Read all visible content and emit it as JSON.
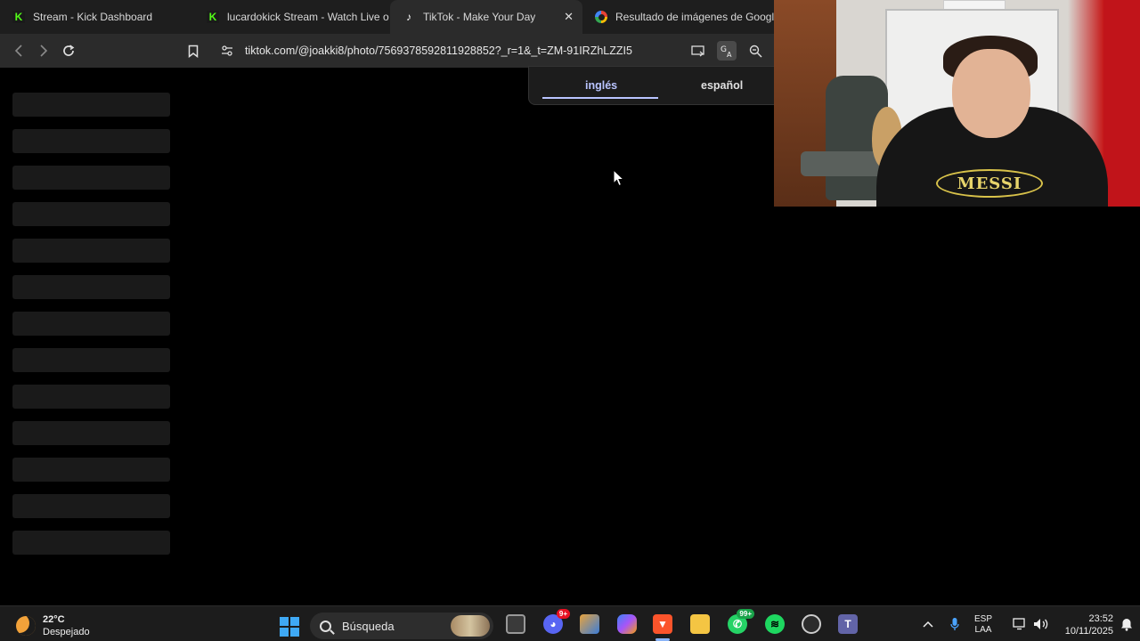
{
  "browser": {
    "tabs": [
      {
        "title": "Stream - Kick Dashboard",
        "favicon": "kick-icon",
        "active": false
      },
      {
        "title": "lucardokick Stream - Watch Live o",
        "favicon": "kick-icon",
        "active": false
      },
      {
        "title": "TikTok - Make Your Day",
        "favicon": "tiktok-icon",
        "active": true
      },
      {
        "title": "Resultado de imágenes de Google",
        "favicon": "google-icon",
        "active": false
      }
    ],
    "url": "tiktok.com/@joakki8/photo/7569378592811928852?_r=1&_t=ZM-91IRZhLZZI5"
  },
  "translate_popup": {
    "source_lang": "inglés",
    "target_lang": "español",
    "selected": "inglés"
  },
  "skeleton_rows": 13,
  "webcam": {
    "shirt_print": "MESSI"
  },
  "taskbar": {
    "weather_temp": "22°C",
    "weather_desc": "Despejado",
    "search_placeholder": "Búsqueda",
    "discord_badge": "9+",
    "whatsapp_badge": "99+",
    "lang_line1": "ESP",
    "lang_line2": "LAA",
    "time": "23:52",
    "date": "10/11/2025"
  },
  "colors": {
    "accent": "#b9c4ff",
    "kick_green": "#53fc18"
  }
}
